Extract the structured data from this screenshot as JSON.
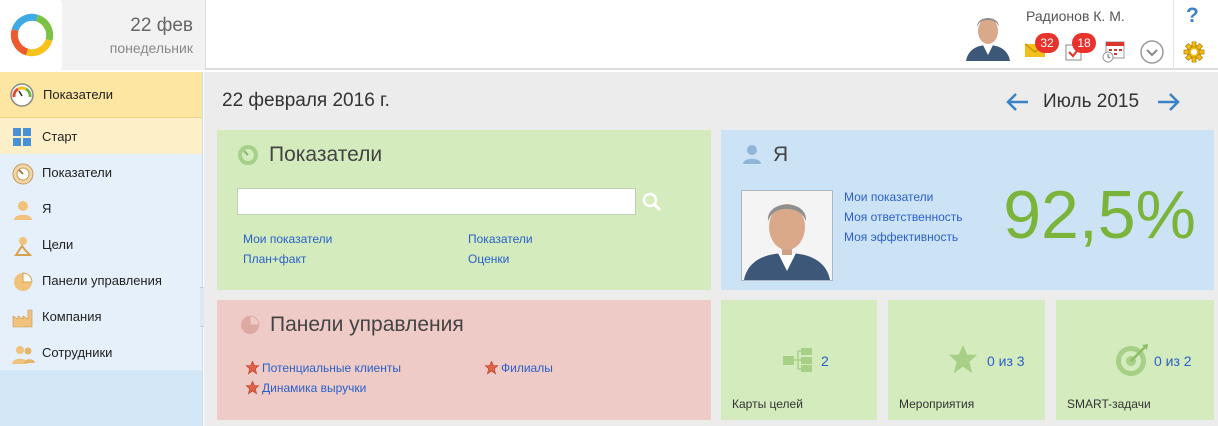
{
  "header": {
    "date_day": "22 фев",
    "date_weekday": "понедельник",
    "user_name": "Радионов К. М.",
    "messages_badge": "32",
    "tasks_badge": "18",
    "help": "?"
  },
  "sidebar": {
    "items": [
      {
        "label": "Показатели",
        "icon": "gauge-icon"
      },
      {
        "label": "Старт",
        "icon": "grid-icon"
      },
      {
        "label": "Показатели",
        "icon": "speedometer-icon"
      },
      {
        "label": "Я",
        "icon": "person-icon"
      },
      {
        "label": "Цели",
        "icon": "goals-icon"
      },
      {
        "label": "Панели управления",
        "icon": "pie-chart-icon"
      },
      {
        "label": "Компания",
        "icon": "factory-icon"
      },
      {
        "label": "Сотрудники",
        "icon": "people-icon"
      }
    ]
  },
  "main": {
    "date": "22 февраля 2016 г.",
    "period": "Июль 2015"
  },
  "indicators": {
    "title": "Показатели",
    "search_placeholder": "",
    "links": [
      "Мои показатели",
      "Показатели",
      "План+факт",
      "Оценки"
    ]
  },
  "me": {
    "title": "Я",
    "links": [
      "Мои показатели",
      "Моя ответственность",
      "Моя эффективность"
    ],
    "efficiency": "92,5%"
  },
  "dashboards": {
    "title": "Панели управления",
    "links": [
      "Потенциальные клиенты",
      "Филиалы",
      "Динамика выручки"
    ]
  },
  "tiles": [
    {
      "label": "Карты целей",
      "value": "2",
      "icon": "org-chart-icon"
    },
    {
      "label": "Мероприятия",
      "value": "0 из 3",
      "icon": "star-icon"
    },
    {
      "label": "SMART-задачи",
      "value": "0 из 2",
      "icon": "target-icon"
    }
  ],
  "colors": {
    "green_card": "#d3ebbd",
    "blue_card": "#cbe3f5",
    "red_card": "#eecbc6",
    "accent_green": "#7ab43a",
    "link_blue": "#2b60c8",
    "badge_red": "#e8332d"
  }
}
